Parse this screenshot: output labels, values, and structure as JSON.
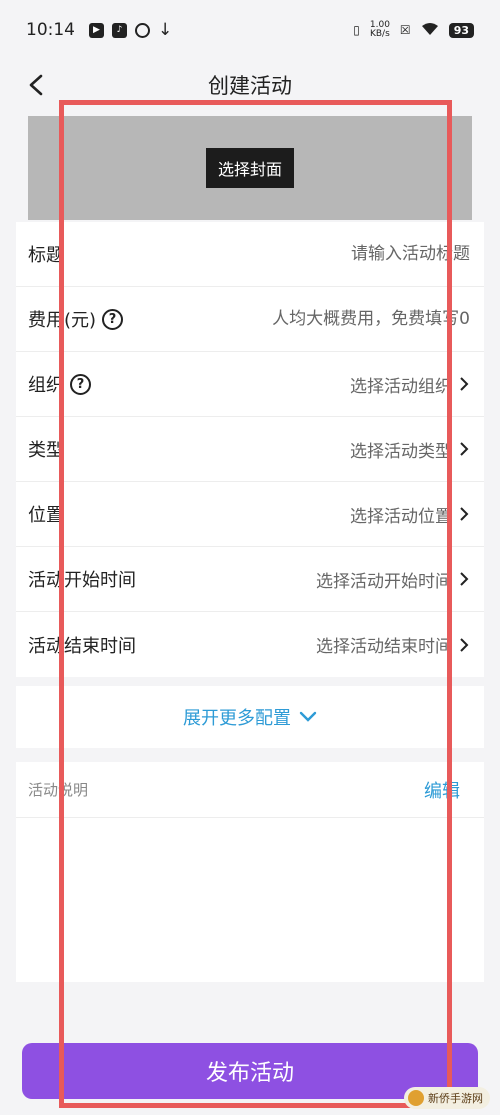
{
  "status_bar": {
    "time": "10:14",
    "net_speed_value": "1.00",
    "net_speed_unit": "KB/s",
    "battery": "93"
  },
  "nav": {
    "title": "创建活动"
  },
  "cover": {
    "button_label": "选择封面"
  },
  "form": {
    "title_label": "标题",
    "title_placeholder": "请输入活动标题",
    "fee_label": "费用(元)",
    "fee_placeholder": "人均大概费用，免费填写0",
    "org_label": "组织",
    "org_value": "选择活动组织",
    "type_label": "类型",
    "type_value": "选择活动类型",
    "location_label": "位置",
    "location_value": "选择活动位置",
    "start_label": "活动开始时间",
    "start_value": "选择活动开始时间",
    "end_label": "活动结束时间",
    "end_value": "选择活动结束时间"
  },
  "more": {
    "label": "展开更多配置"
  },
  "description": {
    "title": "活动说明",
    "edit_label": "编辑"
  },
  "submit": {
    "label": "发布活动"
  },
  "watermark": {
    "text": "新侨手游网"
  },
  "colors": {
    "accent": "#8e50e2",
    "link": "#2e9bd6",
    "annotation": "#e85a5a"
  }
}
